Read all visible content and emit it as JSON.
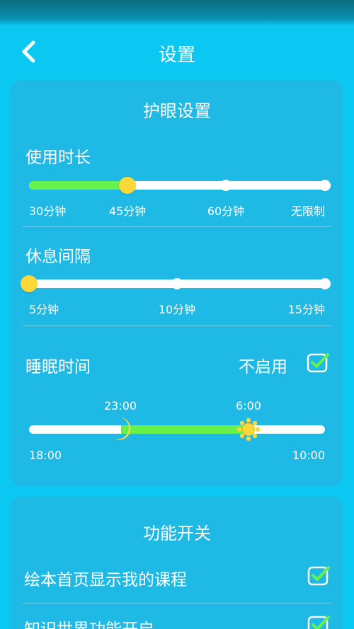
{
  "header": {
    "title": "设置"
  },
  "eye_care": {
    "title": "护眼设置",
    "usage": {
      "label": "使用时长",
      "stops": [
        "30分钟",
        "45分钟",
        "60分钟",
        "无限制"
      ],
      "selected": "45分钟"
    },
    "rest": {
      "label": "休息间隔",
      "stops": [
        "5分钟",
        "10分钟",
        "15分钟"
      ],
      "selected": "5分钟"
    },
    "sleep": {
      "label": "睡眠时间",
      "toggle_label": "不启用",
      "toggle_checked": true,
      "range_start": "18:00",
      "range_end": "10:00",
      "start_time": "23:00",
      "end_time": "6:00"
    }
  },
  "features": {
    "title": "功能开关",
    "items": [
      {
        "label": "绘本首页显示我的课程",
        "checked": true
      },
      {
        "label": "知识世界功能开启",
        "checked": true
      }
    ]
  },
  "colors": {
    "background": "#0bc8f3",
    "card": "#1fb9e6",
    "track": "#ffffff",
    "fill": "#66f24a",
    "knob": "#fcd83a"
  }
}
